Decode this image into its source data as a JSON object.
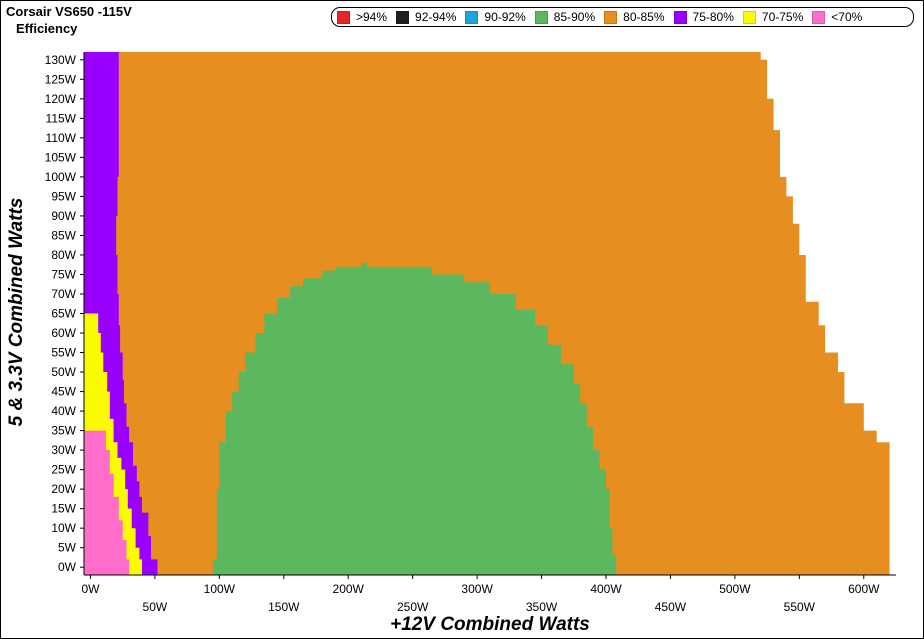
{
  "title": "Corsair VS650 -115V",
  "subtitle": "Efficiency",
  "chart_data": {
    "type": "heatmap",
    "title": "Corsair VS650 -115V",
    "subtitle": "Efficiency",
    "xlabel": "+12V Combined Watts",
    "ylabel": "5 & 3.3V Combined Watts",
    "xlim": [
      -5,
      625
    ],
    "ylim": [
      -2,
      132
    ],
    "x_ticks": [
      "0W",
      "50W",
      "100W",
      "150W",
      "200W",
      "250W",
      "300W",
      "350W",
      "400W",
      "450W",
      "500W",
      "550W",
      "600W"
    ],
    "y_ticks": [
      "0W",
      "5W",
      "10W",
      "15W",
      "20W",
      "25W",
      "30W",
      "35W",
      "40W",
      "45W",
      "50W",
      "55W",
      "60W",
      "65W",
      "70W",
      "75W",
      "80W",
      "85W",
      "90W",
      "95W",
      "100W",
      "105W",
      "110W",
      "115W",
      "120W",
      "125W",
      "130W"
    ],
    "legend": [
      {
        "label": ">94%",
        "color": "#e8232a"
      },
      {
        "label": "92-94%",
        "color": "#1e1e1e"
      },
      {
        "label": "90-92%",
        "color": "#1ea3db"
      },
      {
        "label": "85-90%",
        "color": "#5bb85e"
      },
      {
        "label": "80-85%",
        "color": "#e68f20"
      },
      {
        "label": "75-80%",
        "color": "#9a00ff"
      },
      {
        "label": "70-75%",
        "color": "#fbfb00"
      },
      {
        "label": "<70%",
        "color": "#ff6dcb"
      }
    ],
    "regions": [
      {
        "name": "80-85%",
        "color": "#e68f20",
        "boundary": [
          [
            -5,
            -2
          ],
          [
            620,
            -2
          ],
          [
            620,
            32
          ],
          [
            610,
            32
          ],
          [
            610,
            35
          ],
          [
            600,
            35
          ],
          [
            600,
            42
          ],
          [
            585,
            42
          ],
          [
            585,
            50
          ],
          [
            580,
            50
          ],
          [
            580,
            55
          ],
          [
            570,
            55
          ],
          [
            570,
            62
          ],
          [
            565,
            62
          ],
          [
            565,
            68
          ],
          [
            555,
            68
          ],
          [
            555,
            80
          ],
          [
            550,
            80
          ],
          [
            550,
            88
          ],
          [
            545,
            88
          ],
          [
            545,
            95
          ],
          [
            540,
            95
          ],
          [
            540,
            100
          ],
          [
            535,
            100
          ],
          [
            535,
            112
          ],
          [
            530,
            112
          ],
          [
            530,
            120
          ],
          [
            525,
            120
          ],
          [
            525,
            130
          ],
          [
            520,
            130
          ],
          [
            520,
            132
          ],
          [
            -5,
            132
          ]
        ]
      },
      {
        "name": "75-80%",
        "color": "#9a00ff",
        "boundary": [
          [
            -5,
            -2
          ],
          [
            52,
            -2
          ],
          [
            52,
            2
          ],
          [
            47,
            2
          ],
          [
            47,
            8
          ],
          [
            45,
            8
          ],
          [
            45,
            14
          ],
          [
            40,
            14
          ],
          [
            40,
            18
          ],
          [
            38,
            18
          ],
          [
            38,
            22
          ],
          [
            36,
            22
          ],
          [
            36,
            26
          ],
          [
            33,
            26
          ],
          [
            33,
            32
          ],
          [
            30,
            32
          ],
          [
            30,
            36
          ],
          [
            28,
            36
          ],
          [
            28,
            42
          ],
          [
            26,
            42
          ],
          [
            26,
            48
          ],
          [
            25,
            48
          ],
          [
            25,
            55
          ],
          [
            23,
            55
          ],
          [
            23,
            62
          ],
          [
            22,
            62
          ],
          [
            22,
            70
          ],
          [
            21,
            70
          ],
          [
            21,
            80
          ],
          [
            20,
            80
          ],
          [
            20,
            90
          ],
          [
            21,
            90
          ],
          [
            21,
            100
          ],
          [
            22,
            100
          ],
          [
            22,
            110
          ],
          [
            22,
            110
          ],
          [
            22,
            120
          ],
          [
            22,
            120
          ],
          [
            22,
            132
          ],
          [
            -5,
            132
          ]
        ]
      },
      {
        "name": "70-75%",
        "color": "#fbfb00",
        "boundary": [
          [
            -5,
            -2
          ],
          [
            40,
            -2
          ],
          [
            40,
            2
          ],
          [
            38,
            2
          ],
          [
            38,
            5
          ],
          [
            35,
            5
          ],
          [
            35,
            10
          ],
          [
            32,
            10
          ],
          [
            32,
            15
          ],
          [
            29,
            15
          ],
          [
            29,
            20
          ],
          [
            27,
            20
          ],
          [
            27,
            25
          ],
          [
            24,
            25
          ],
          [
            24,
            28
          ],
          [
            21,
            28
          ],
          [
            21,
            32
          ],
          [
            18,
            32
          ],
          [
            18,
            38
          ],
          [
            15,
            38
          ],
          [
            15,
            45
          ],
          [
            13,
            45
          ],
          [
            13,
            50
          ],
          [
            10,
            50
          ],
          [
            10,
            55
          ],
          [
            8,
            55
          ],
          [
            8,
            60
          ],
          [
            6,
            60
          ],
          [
            6,
            65
          ],
          [
            -5,
            65
          ]
        ]
      },
      {
        "name": "<70%",
        "color": "#ff6dcb",
        "boundary": [
          [
            -5,
            -2
          ],
          [
            30,
            -2
          ],
          [
            30,
            2
          ],
          [
            28,
            2
          ],
          [
            28,
            7
          ],
          [
            25,
            7
          ],
          [
            25,
            12
          ],
          [
            22,
            12
          ],
          [
            22,
            18
          ],
          [
            18,
            18
          ],
          [
            18,
            24
          ],
          [
            15,
            24
          ],
          [
            15,
            30
          ],
          [
            12,
            30
          ],
          [
            12,
            35
          ],
          [
            -5,
            35
          ]
        ]
      },
      {
        "name": "85-90%",
        "color": "#5bb85e",
        "boundary": [
          [
            95,
            -2
          ],
          [
            408,
            -2
          ],
          [
            408,
            3
          ],
          [
            405,
            3
          ],
          [
            405,
            10
          ],
          [
            403,
            10
          ],
          [
            403,
            20
          ],
          [
            400,
            20
          ],
          [
            400,
            25
          ],
          [
            395,
            25
          ],
          [
            395,
            30
          ],
          [
            390,
            30
          ],
          [
            390,
            36
          ],
          [
            385,
            36
          ],
          [
            385,
            42
          ],
          [
            380,
            42
          ],
          [
            380,
            47
          ],
          [
            375,
            47
          ],
          [
            375,
            52
          ],
          [
            365,
            52
          ],
          [
            365,
            57
          ],
          [
            355,
            57
          ],
          [
            355,
            62
          ],
          [
            345,
            62
          ],
          [
            345,
            66
          ],
          [
            330,
            66
          ],
          [
            330,
            70
          ],
          [
            310,
            70
          ],
          [
            310,
            73
          ],
          [
            290,
            73
          ],
          [
            290,
            75
          ],
          [
            265,
            75
          ],
          [
            265,
            77
          ],
          [
            215,
            77
          ],
          [
            215,
            78
          ],
          [
            210,
            78
          ],
          [
            210,
            77
          ],
          [
            190,
            77
          ],
          [
            190,
            76
          ],
          [
            180,
            76
          ],
          [
            180,
            74
          ],
          [
            165,
            74
          ],
          [
            165,
            72
          ],
          [
            155,
            72
          ],
          [
            155,
            69
          ],
          [
            145,
            69
          ],
          [
            145,
            65
          ],
          [
            135,
            65
          ],
          [
            135,
            60
          ],
          [
            128,
            60
          ],
          [
            128,
            55
          ],
          [
            120,
            55
          ],
          [
            120,
            50
          ],
          [
            115,
            50
          ],
          [
            115,
            45
          ],
          [
            110,
            45
          ],
          [
            110,
            40
          ],
          [
            105,
            40
          ],
          [
            105,
            32
          ],
          [
            100,
            32
          ],
          [
            100,
            20
          ],
          [
            98,
            20
          ],
          [
            98,
            2
          ],
          [
            95,
            2
          ]
        ]
      }
    ]
  }
}
